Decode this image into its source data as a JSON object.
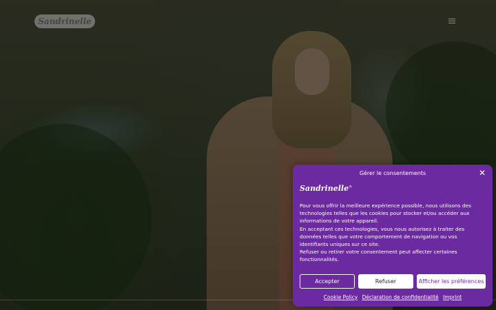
{
  "header": {
    "logo_text": "Sandrinelle",
    "menu_icon": "hamburger-icon"
  },
  "consent": {
    "title": "Gérer le consentements",
    "close_icon": "close-icon",
    "logo_text": "Sandrinelle",
    "logo_mark": "®",
    "paragraphs": [
      "Pour vous offrir la meilleure expérience possible, nous utilisons des technologies telles que les cookies pour stocker et/ou accéder aux informations de votre appareil.",
      "En acceptant ces technologies, vous nous autorisez à traiter des données telles que votre comportement de navigation ou vos identifiants uniques sur ce site.",
      "Refuser ou retirer votre consentement peut affecter certaines fonctionnalités."
    ],
    "buttons": {
      "accept": "Accepter",
      "refuse": "Refuser",
      "preferences": "Afficher les préférences"
    },
    "links": {
      "cookie_policy": "Cookie Policy",
      "privacy": "Déclaration de confidentialité",
      "imprint": "Imprint"
    },
    "colors": {
      "accent": "#6c2aa0",
      "text": "#ffffff"
    }
  }
}
